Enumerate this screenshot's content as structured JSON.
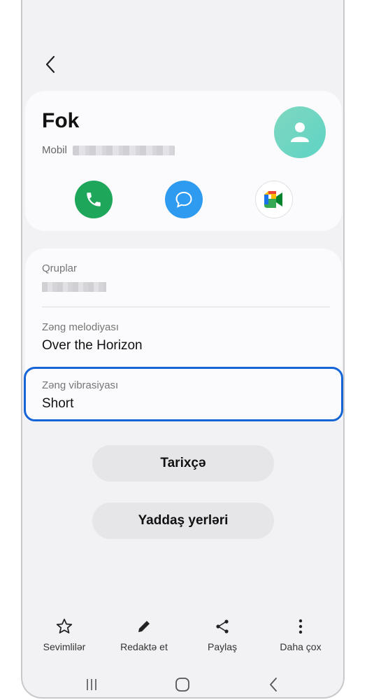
{
  "contact": {
    "name": "Fok",
    "phone_type": "Mobil"
  },
  "colors": {
    "call": "#1ea65a",
    "message": "#2f9bf0",
    "highlight": "#1565d8",
    "avatar": "#6ad6c2"
  },
  "info": {
    "groups_label": "Qruplar",
    "ringtone_label": "Zəng melodiyası",
    "ringtone_value": "Over the Horizon",
    "vibration_label": "Zəng vibrasiyası",
    "vibration_value": "Short"
  },
  "buttons": {
    "history": "Tarixçə",
    "storage": "Yaddaş yerləri"
  },
  "bottom_bar": {
    "favorites": "Sevimlilər",
    "edit": "Redaktə et",
    "share": "Paylaş",
    "more": "Daha çox"
  },
  "icons": [
    "back-icon",
    "person-icon",
    "phone-icon",
    "message-icon",
    "video-meet-icon",
    "star-icon",
    "pencil-icon",
    "share-icon",
    "more-vert-icon",
    "recents-icon",
    "home-icon",
    "nav-back-icon"
  ]
}
